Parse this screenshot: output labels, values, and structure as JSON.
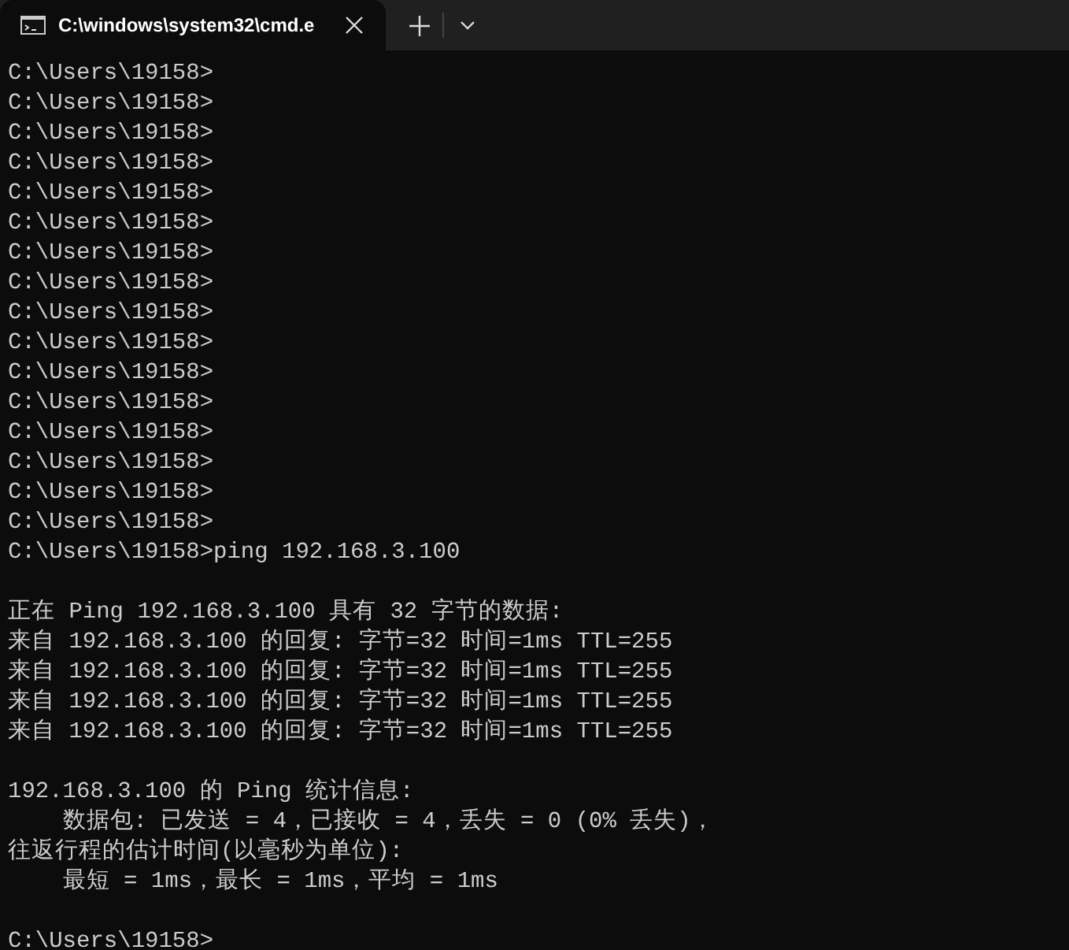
{
  "tab": {
    "title": "C:\\windows\\system32\\cmd.e",
    "selected": true
  },
  "terminal": {
    "blocks": [
      [
        "C:\\Users\\19158>",
        "C:\\Users\\19158>",
        "C:\\Users\\19158>",
        "C:\\Users\\19158>",
        "C:\\Users\\19158>",
        "C:\\Users\\19158>",
        "C:\\Users\\19158>",
        "C:\\Users\\19158>",
        "C:\\Users\\19158>",
        "C:\\Users\\19158>",
        "C:\\Users\\19158>",
        "C:\\Users\\19158>",
        "C:\\Users\\19158>",
        "C:\\Users\\19158>",
        "C:\\Users\\19158>",
        "C:\\Users\\19158>",
        "C:\\Users\\19158>ping 192.168.3.100"
      ],
      [
        "正在 Ping 192.168.3.100 具有 32 字节的数据:",
        "来自 192.168.3.100 的回复: 字节=32 时间=1ms TTL=255",
        "来自 192.168.3.100 的回复: 字节=32 时间=1ms TTL=255",
        "来自 192.168.3.100 的回复: 字节=32 时间=1ms TTL=255",
        "来自 192.168.3.100 的回复: 字节=32 时间=1ms TTL=255"
      ],
      [
        "192.168.3.100 的 Ping 统计信息:",
        "    数据包: 已发送 = 4，已接收 = 4，丢失 = 0 (0% 丢失)，",
        "往返行程的估计时间(以毫秒为单位):",
        "    最短 = 1ms，最长 = 1ms，平均 = 1ms"
      ],
      [
        "C:\\Users\\19158>"
      ]
    ]
  }
}
